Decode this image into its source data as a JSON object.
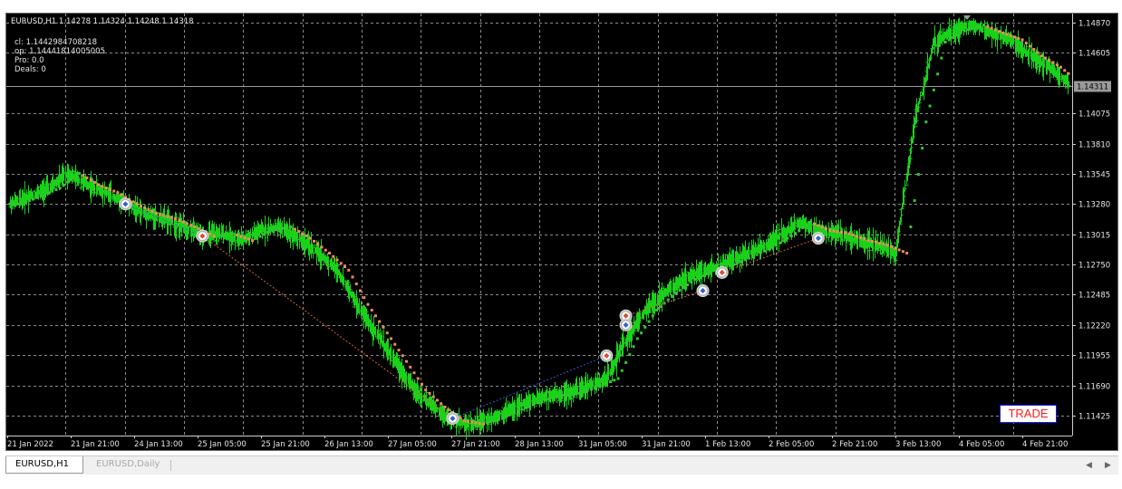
{
  "symbol_info": "EURUSD,H1  1.14278 1.14324 1.14248 1.14318",
  "indicator_lines": [
    "cl: 1.1442984708218",
    "op: 1.14441814005005",
    "Pro: 0.0",
    "Deals: 0"
  ],
  "price_axis": [
    "1.14870",
    "1.14605",
    "1.14075",
    "1.13810",
    "1.13545",
    "1.13280",
    "1.13015",
    "1.12750",
    "1.12485",
    "1.12220",
    "1.11955",
    "1.11690",
    "1.11425"
  ],
  "current_price_label": "1.14311",
  "time_axis": [
    "21 Jan 2022",
    "21 Jan 21:00",
    "24 Jan 13:00",
    "25 Jan 05:00",
    "25 Jan 21:00",
    "26 Jan 13:00",
    "27 Jan 05:00",
    "27 Jan 21:00",
    "28 Jan 13:00",
    "31 Jan 05:00",
    "31 Jan 21:00",
    "1 Feb 13:00",
    "2 Feb 05:00",
    "2 Feb 21:00",
    "3 Feb 13:00",
    "4 Feb 05:00",
    "4 Feb 21:00"
  ],
  "trade_button": "TRADE",
  "tabs": [
    {
      "label": "EURUSD,H1",
      "active": true
    },
    {
      "label": "EURUSD,Daily",
      "active": false
    }
  ],
  "colors": {
    "background": "#000000",
    "candle": "#19d219",
    "up_dots": "#33c633",
    "down_dots": "#f08b5a",
    "grid": "#8c8c8c",
    "text": "#e6e6e6",
    "trade_text": "#ff1a1a",
    "trade_border": "#1a1aff"
  },
  "chart_data": {
    "type": "line",
    "ylim": [
      1.1125,
      1.1495
    ],
    "series": [
      {
        "values": [
          1.1328,
          1.1335,
          1.1342,
          1.1355,
          1.1345,
          1.1338,
          1.1328,
          1.132,
          1.1315,
          1.1308,
          1.13,
          1.1302,
          1.1296,
          1.1305,
          1.1308,
          1.1298,
          1.1285,
          1.127,
          1.124,
          1.1215,
          1.119,
          1.1165,
          1.115,
          1.1138,
          1.1135,
          1.114,
          1.1148,
          1.1155,
          1.116,
          1.1162,
          1.1168,
          1.1175,
          1.121,
          1.1235,
          1.125,
          1.1262,
          1.127,
          1.1275,
          1.1282,
          1.129,
          1.13,
          1.1312,
          1.1305,
          1.1302,
          1.1296,
          1.1292,
          1.1285,
          1.14,
          1.147,
          1.148,
          1.1485,
          1.1478,
          1.1472,
          1.1458,
          1.1448,
          1.1434
        ]
      }
    ],
    "markers": [
      {
        "i": 6,
        "y": 1.1328,
        "kind": "buy"
      },
      {
        "i": 10,
        "y": 1.13,
        "kind": "sell"
      },
      {
        "i": 23,
        "y": 1.114,
        "kind": "buy"
      },
      {
        "i": 31,
        "y": 1.1195,
        "kind": "sell"
      },
      {
        "i": 32,
        "y": 1.123,
        "kind": "sell"
      },
      {
        "i": 32,
        "y": 1.1222,
        "kind": "buy"
      },
      {
        "i": 36,
        "y": 1.1252,
        "kind": "buy"
      },
      {
        "i": 37,
        "y": 1.1268,
        "kind": "sell"
      },
      {
        "i": 42,
        "y": 1.1298,
        "kind": "buy"
      }
    ],
    "trade_links": [
      [
        6,
        10
      ],
      [
        10,
        23
      ],
      [
        23,
        31
      ],
      [
        32,
        36
      ],
      [
        37,
        42
      ]
    ]
  }
}
